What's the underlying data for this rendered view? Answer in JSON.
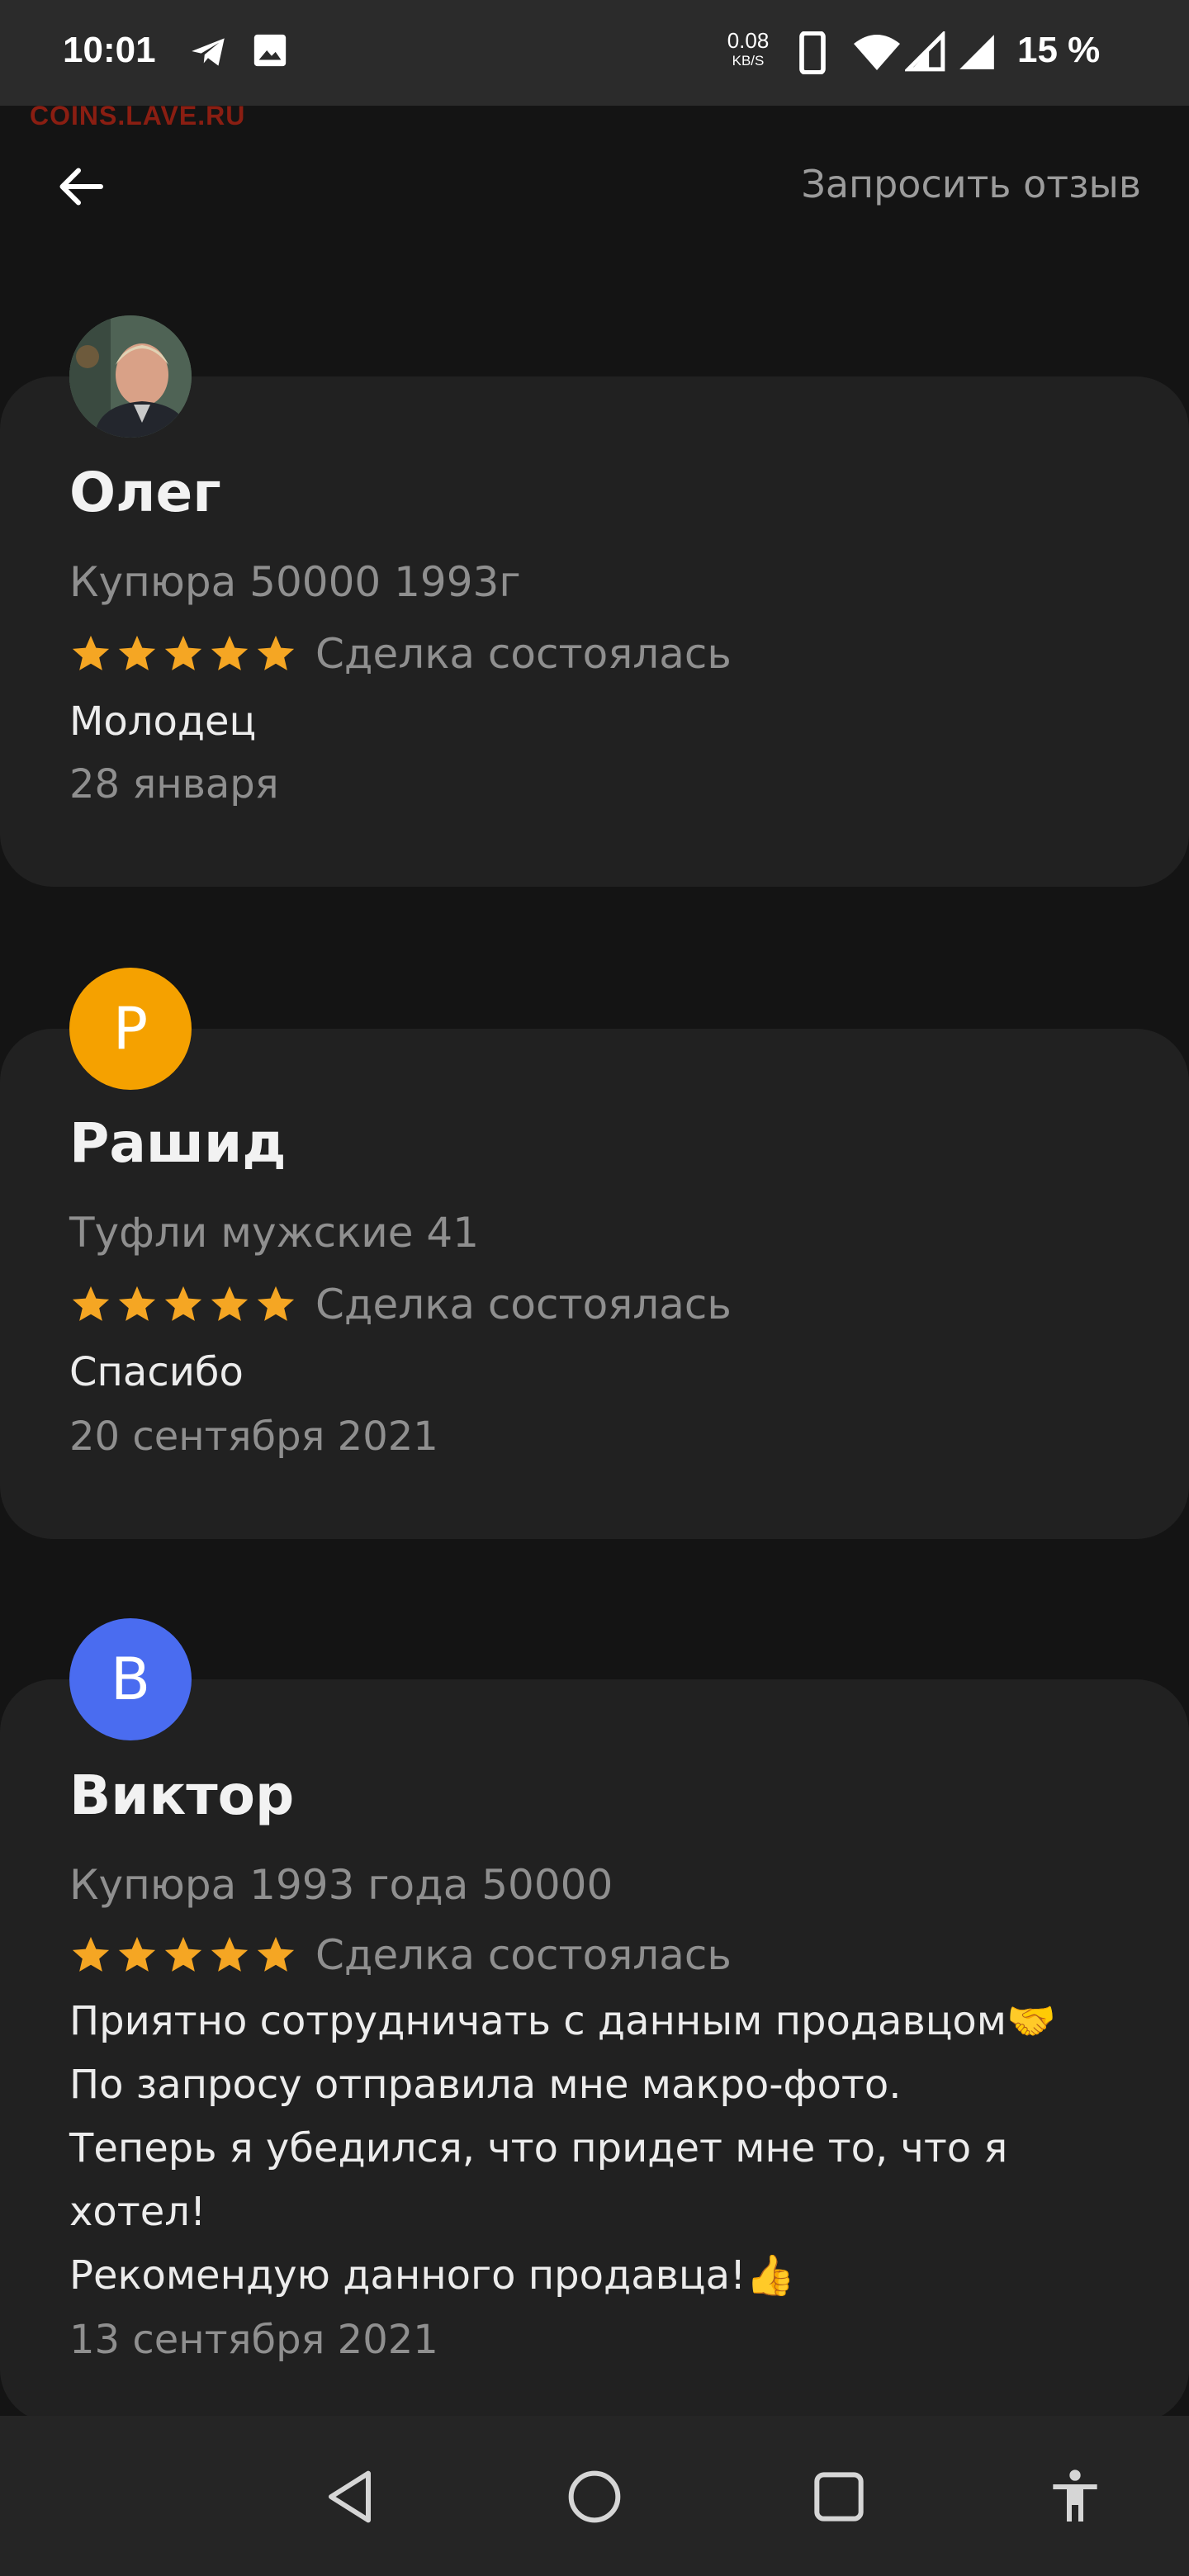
{
  "status_bar": {
    "time": "10:01",
    "speed_value": "0.08",
    "speed_unit": "KB/S",
    "battery": "15 %",
    "icons": [
      "telegram-icon",
      "image-icon",
      "phone-icon",
      "wifi-icon",
      "signal-icon",
      "signal-icon-2"
    ]
  },
  "watermark": "COINS.LAVE.RU",
  "header": {
    "back_icon": "arrow-left-icon",
    "request_review_label": "Запросить отзыв"
  },
  "reviews": [
    {
      "name": "Олег",
      "avatar_type": "photo",
      "item": "Купюра 50000 1993г",
      "rating": 5,
      "deal_status": "Сделка состоялась",
      "text": "Молодец",
      "date": "28 января"
    },
    {
      "name": "Рашид",
      "avatar_type": "initial",
      "avatar_letter": "Р",
      "avatar_color": "#f5a100",
      "item": "Туфли мужские 41",
      "rating": 5,
      "deal_status": "Сделка состоялась",
      "text": "Спасибо",
      "date": "20 сентября 2021"
    },
    {
      "name": "Виктор",
      "avatar_type": "initial",
      "avatar_letter": "В",
      "avatar_color": "#4a6cf0",
      "item": "Купюра 1993 года 50000",
      "rating": 5,
      "deal_status": "Сделка состоялась",
      "text_lines": [
        "Приятно сотрудничать с данным продавцом🤝",
        "По запросу отправила мне макро-фото.",
        "Теперь я убедился, что придет мне то, что я хотел!",
        "Рекомендую данного продавца!👍"
      ],
      "date": "13 сентября 2021"
    }
  ],
  "nav_bar": {
    "buttons": [
      "back-triangle-icon",
      "home-circle-icon",
      "recents-square-icon",
      "accessibility-icon"
    ]
  },
  "colors": {
    "background": "#141414",
    "card": "#212121",
    "star": "#f5a623",
    "secondary_text": "#8f8f8f"
  }
}
